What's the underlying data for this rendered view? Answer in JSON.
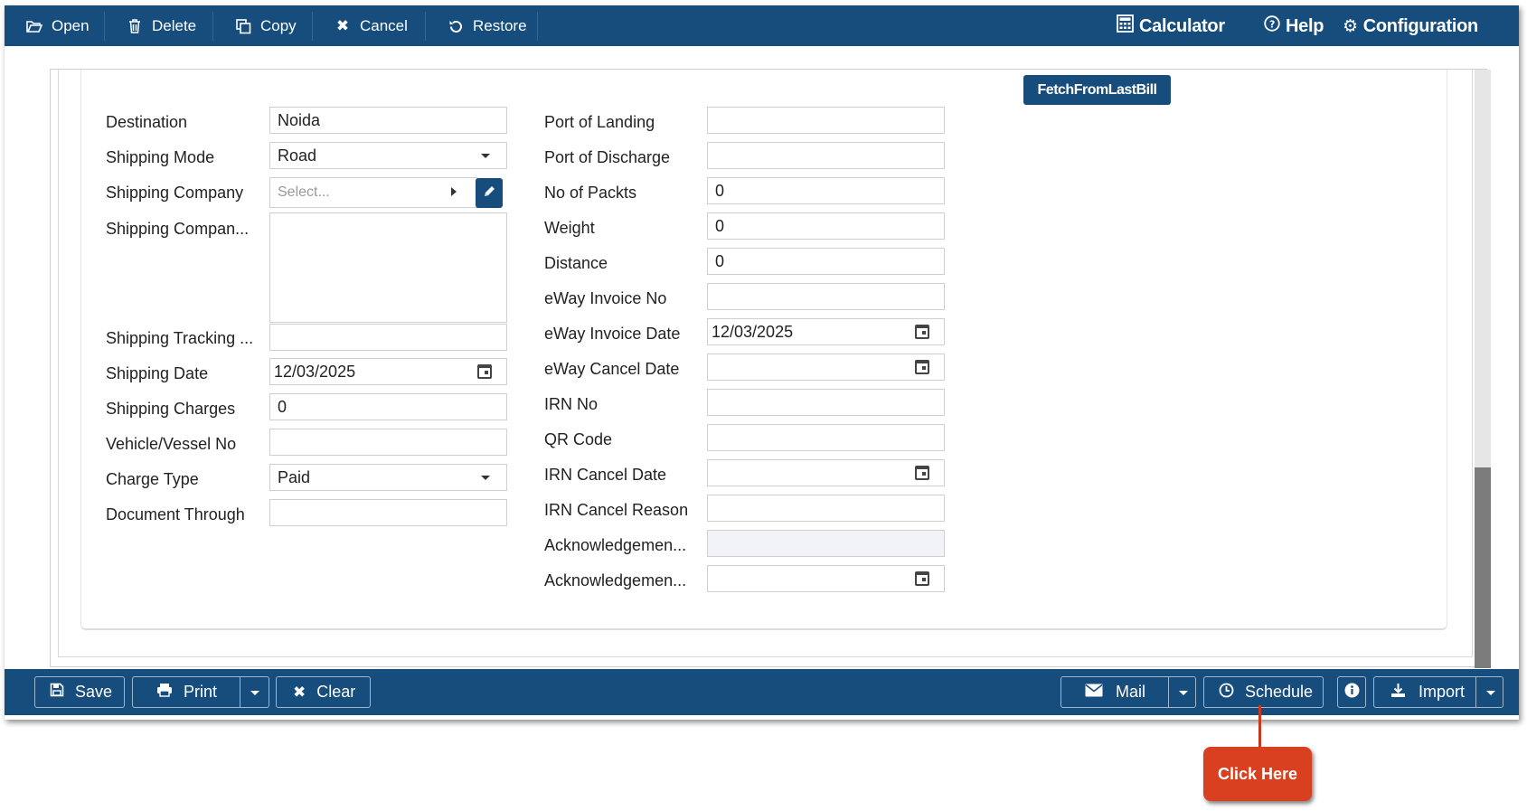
{
  "toolbar": {
    "open": "Open",
    "delete": "Delete",
    "copy": "Copy",
    "cancel": "Cancel",
    "restore": "Restore",
    "calculator": "Calculator",
    "help": "Help",
    "configuration": "Configuration"
  },
  "fetch_button": "FetchFromLastBill",
  "left_form": {
    "destination": {
      "label": "Destination",
      "value": "Noida"
    },
    "shipping_mode": {
      "label": "Shipping Mode",
      "value": "Road"
    },
    "shipping_company": {
      "label": "Shipping Company",
      "placeholder": "Select..."
    },
    "shipping_company_address": {
      "label": "Shipping Compan...",
      "value": ""
    },
    "shipping_tracking": {
      "label": "Shipping Tracking ...",
      "value": ""
    },
    "shipping_date": {
      "label": "Shipping Date",
      "value": "12/03/2025"
    },
    "shipping_charges": {
      "label": "Shipping Charges",
      "value": "0"
    },
    "vehicle_no": {
      "label": "Vehicle/Vessel No",
      "value": ""
    },
    "charge_type": {
      "label": "Charge Type",
      "value": "Paid"
    },
    "document_through": {
      "label": "Document Through",
      "value": ""
    }
  },
  "right_form": {
    "port_of_landing": {
      "label": "Port of Landing",
      "value": ""
    },
    "port_of_discharge": {
      "label": "Port of Discharge",
      "value": ""
    },
    "no_of_packts": {
      "label": "No of Packts",
      "value": "0"
    },
    "weight": {
      "label": "Weight",
      "value": "0"
    },
    "distance": {
      "label": "Distance",
      "value": "0"
    },
    "eway_invoice_no": {
      "label": "eWay Invoice No",
      "value": ""
    },
    "eway_invoice_date": {
      "label": "eWay Invoice Date",
      "value": "12/03/2025"
    },
    "eway_cancel_date": {
      "label": "eWay Cancel Date",
      "value": ""
    },
    "irn_no": {
      "label": "IRN No",
      "value": ""
    },
    "qr_code": {
      "label": "QR Code",
      "value": ""
    },
    "irn_cancel_date": {
      "label": "IRN Cancel Date",
      "value": ""
    },
    "irn_cancel_reason": {
      "label": "IRN Cancel Reason",
      "value": ""
    },
    "ack_no": {
      "label": "Acknowledgemen...",
      "value": ""
    },
    "ack_date": {
      "label": "Acknowledgemen...",
      "value": ""
    }
  },
  "bottombar": {
    "save": "Save",
    "print": "Print",
    "clear": "Clear",
    "mail": "Mail",
    "schedule": "Schedule",
    "import": "Import"
  },
  "callout": "Click Here",
  "colors": {
    "primary": "#174d7c",
    "callout": "#d9401f"
  }
}
